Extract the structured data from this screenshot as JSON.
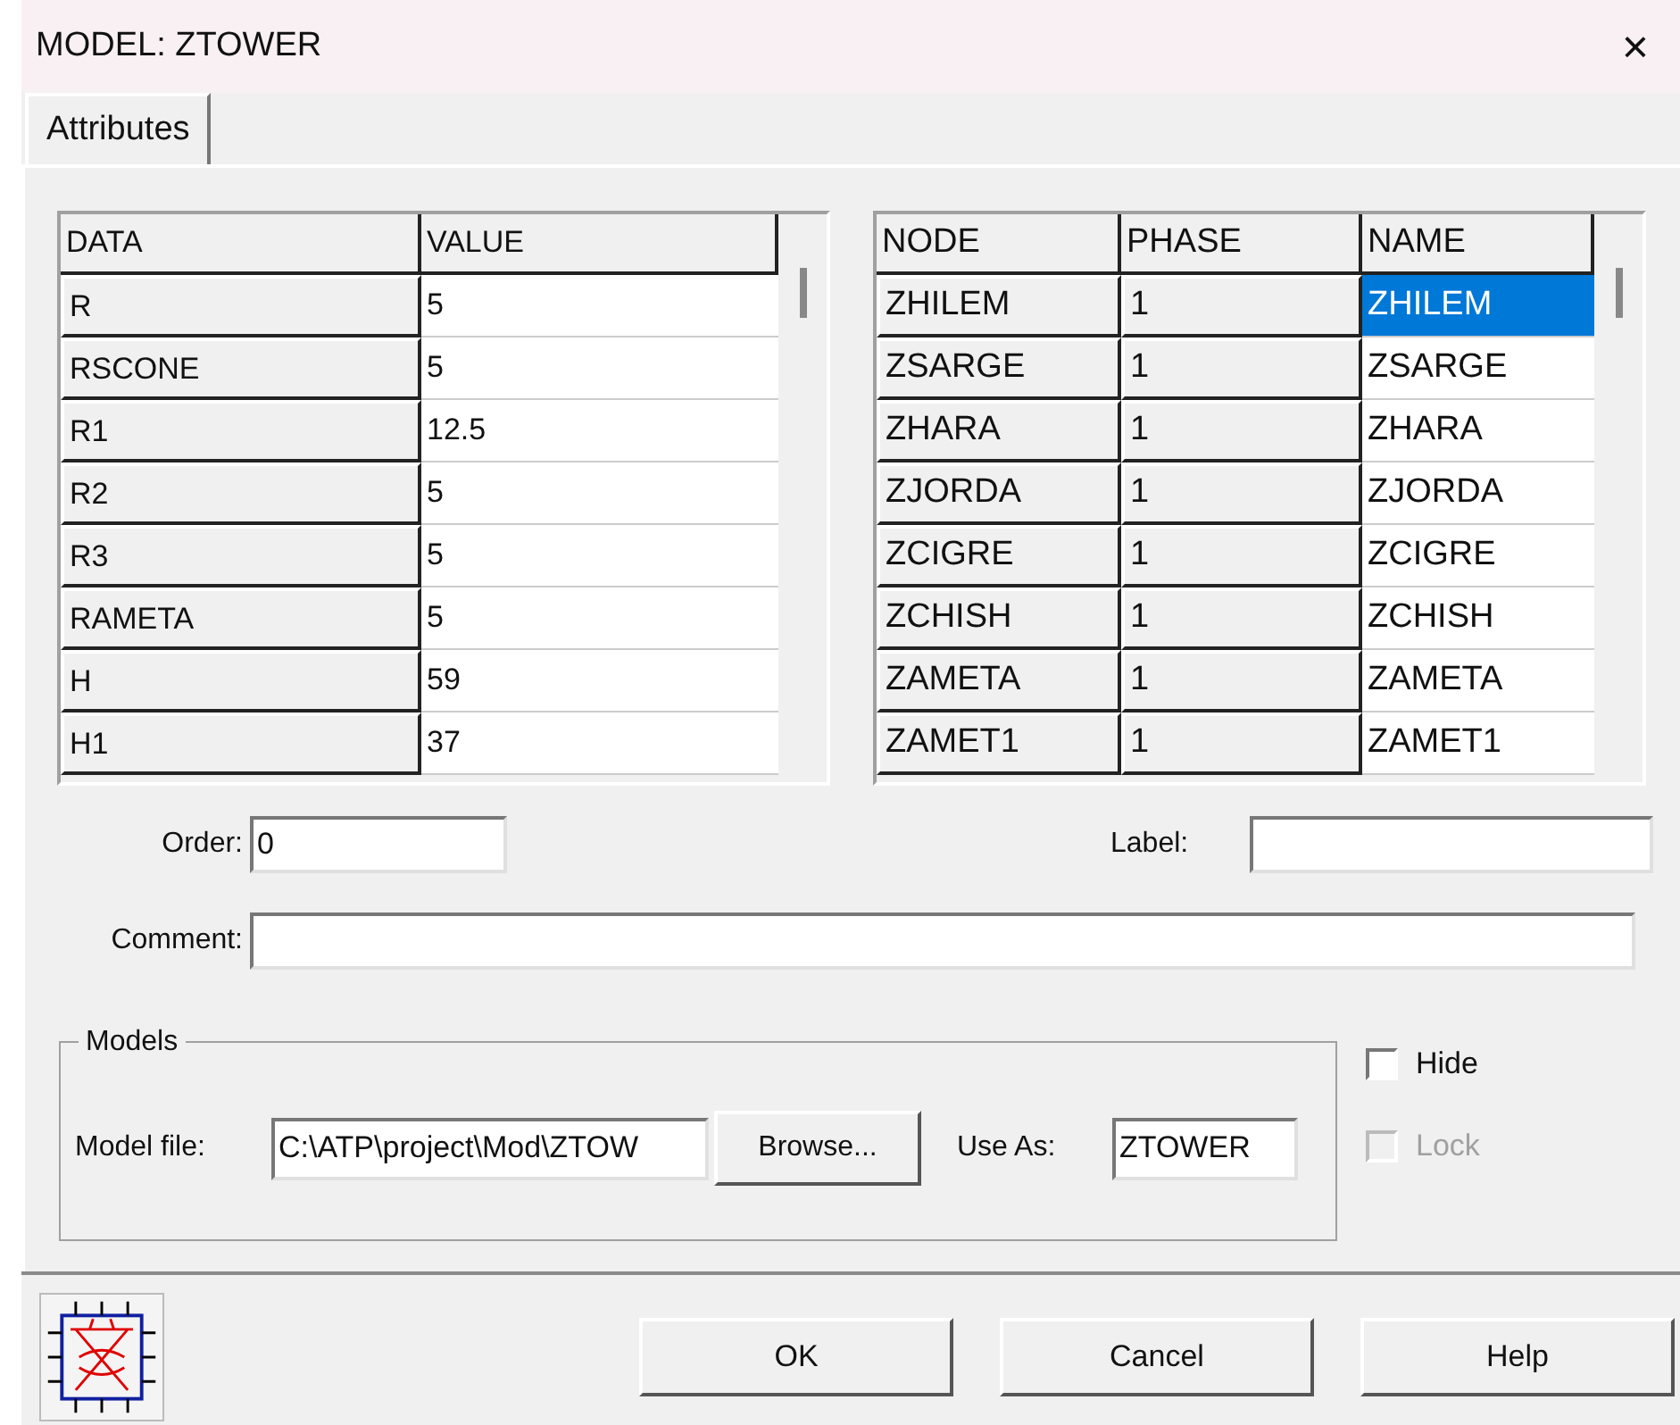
{
  "window": {
    "title": "MODEL: ZTOWER",
    "close": "×"
  },
  "tabs": [
    {
      "label": "Attributes",
      "selected": true
    }
  ],
  "data_table": {
    "columns": [
      "DATA",
      "VALUE"
    ],
    "rows": [
      [
        "R",
        "5"
      ],
      [
        "RSCONE",
        "5"
      ],
      [
        "R1",
        "12.5"
      ],
      [
        "R2",
        "5"
      ],
      [
        "R3",
        "5"
      ],
      [
        "RAMETA",
        "5"
      ],
      [
        "H",
        "59"
      ],
      [
        "H1",
        "37"
      ]
    ]
  },
  "node_table": {
    "columns": [
      "NODE",
      "PHASE",
      "NAME"
    ],
    "rows": [
      {
        "cells": [
          "ZHILEM",
          "1",
          "ZHILEM"
        ],
        "selected": true
      },
      {
        "cells": [
          "ZSARGE",
          "1",
          "ZSARGE"
        ],
        "selected": false
      },
      {
        "cells": [
          "ZHARA",
          "1",
          "ZHARA"
        ],
        "selected": false
      },
      {
        "cells": [
          "ZJORDA",
          "1",
          "ZJORDA"
        ],
        "selected": false
      },
      {
        "cells": [
          "ZCIGRE",
          "1",
          "ZCIGRE"
        ],
        "selected": false
      },
      {
        "cells": [
          "ZCHISH",
          "1",
          "ZCHISH"
        ],
        "selected": false
      },
      {
        "cells": [
          "ZAMETA",
          "1",
          "ZAMETA"
        ],
        "selected": false
      },
      {
        "cells": [
          "ZAMET1",
          "1",
          "ZAMET1"
        ],
        "selected": false
      }
    ]
  },
  "order": {
    "label": "Order:",
    "value": "0"
  },
  "label_field": {
    "label": "Label:"
  },
  "comment": {
    "label": "Comment:"
  },
  "models": {
    "legend": "Models",
    "model_file": {
      "label": "Model file:",
      "value": "C:\\ATP\\project\\Mod\\ZTOW"
    },
    "browse": "Browse...",
    "use_as": {
      "label": "Use As:",
      "value": "ZTOWER"
    }
  },
  "options": [
    {
      "label": "Hide",
      "checked": false,
      "disabled": false
    },
    {
      "label": "Lock",
      "checked": false,
      "disabled": true
    }
  ],
  "buttons": [
    "OK",
    "Cancel",
    "Help"
  ]
}
